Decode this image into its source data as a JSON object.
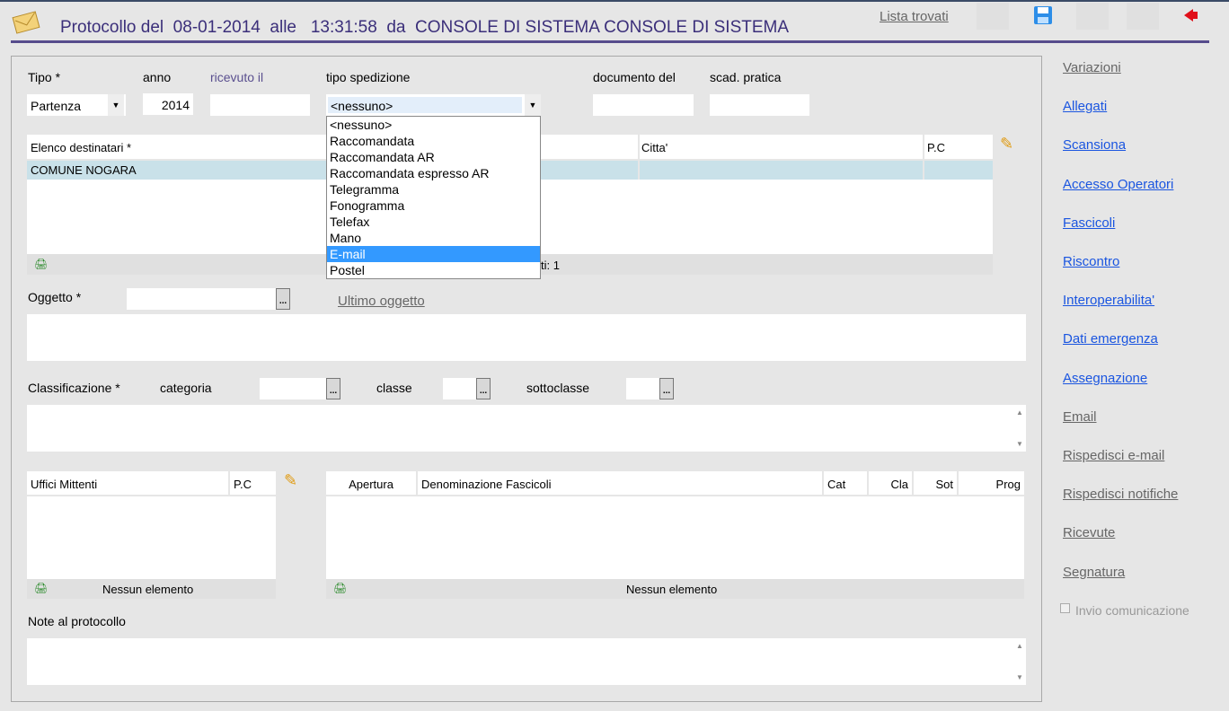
{
  "header": {
    "title": "Protocollo del  08-01-2014  alle   13:31:58  da  CONSOLE DI SISTEMA CONSOLE DI SISTEMA",
    "lista_trovati": "Lista trovati"
  },
  "form": {
    "tipo_label": "Tipo  *",
    "tipo_value": "Partenza",
    "anno_label": "anno",
    "anno_value": "2014",
    "ricevuto_label": "ricevuto il",
    "spedizione_label": "tipo spedizione",
    "spedizione_value": "<nessuno>",
    "spedizione_options": [
      "<nessuno>",
      "Raccomandata",
      "Raccomandata AR",
      "Raccomandata espresso AR",
      "Telegramma",
      "Fonogramma",
      "Telefax",
      "Mano",
      "E-mail",
      "Postel"
    ],
    "spedizione_highlighted": "E-mail",
    "documento_label": "documento del",
    "scad_label": "scad. pratica",
    "oggetto_label": "Oggetto *",
    "ultimo_oggetto": "Ultimo oggetto",
    "classificazione_label": "Classificazione *",
    "categoria_label": "categoria",
    "classe_label": "classe",
    "sottoclasse_label": "sottoclasse",
    "note_label": "Note al protocollo"
  },
  "destinatari": {
    "columns": [
      "Elenco destinatari *",
      "Citta'",
      "P.C"
    ],
    "rows": [
      [
        "COMUNE NOGARA",
        "",
        ""
      ]
    ],
    "footer": "ti: 1"
  },
  "uffici": {
    "columns": [
      "Uffici Mittenti",
      "P.C"
    ],
    "footer": "Nessun elemento"
  },
  "fascicoli": {
    "columns": [
      "Apertura",
      "Denominazione Fascicoli",
      "Cat",
      "Cla",
      "Sot",
      "Prog"
    ],
    "footer": "Nessun elemento"
  },
  "sidebar": {
    "items": [
      {
        "label": "Variazioni",
        "color": "gray"
      },
      {
        "label": "Allegati",
        "color": "blue"
      },
      {
        "label": "Scansiona",
        "color": "blue"
      },
      {
        "label": "Accesso Operatori",
        "color": "blue"
      },
      {
        "label": "Fascicoli",
        "color": "blue"
      },
      {
        "label": "Riscontro",
        "color": "blue"
      },
      {
        "label": "Interoperabilita'",
        "color": "blue"
      },
      {
        "label": "Dati emergenza",
        "color": "blue"
      },
      {
        "label": "Assegnazione",
        "color": "blue"
      },
      {
        "label": "Email",
        "color": "gray"
      },
      {
        "label": "Rispedisci e-mail",
        "color": "gray"
      },
      {
        "label": "Rispedisci notifiche",
        "color": "gray"
      },
      {
        "label": "Ricevute",
        "color": "gray"
      },
      {
        "label": "Segnatura",
        "color": "gray"
      }
    ],
    "invio_label": "Invio comunicazione"
  },
  "colors": {
    "title": "#3b2f7a",
    "link_blue": "#1a55e0",
    "highlight": "#3399ff",
    "selected_row": "#c9e1e9"
  }
}
